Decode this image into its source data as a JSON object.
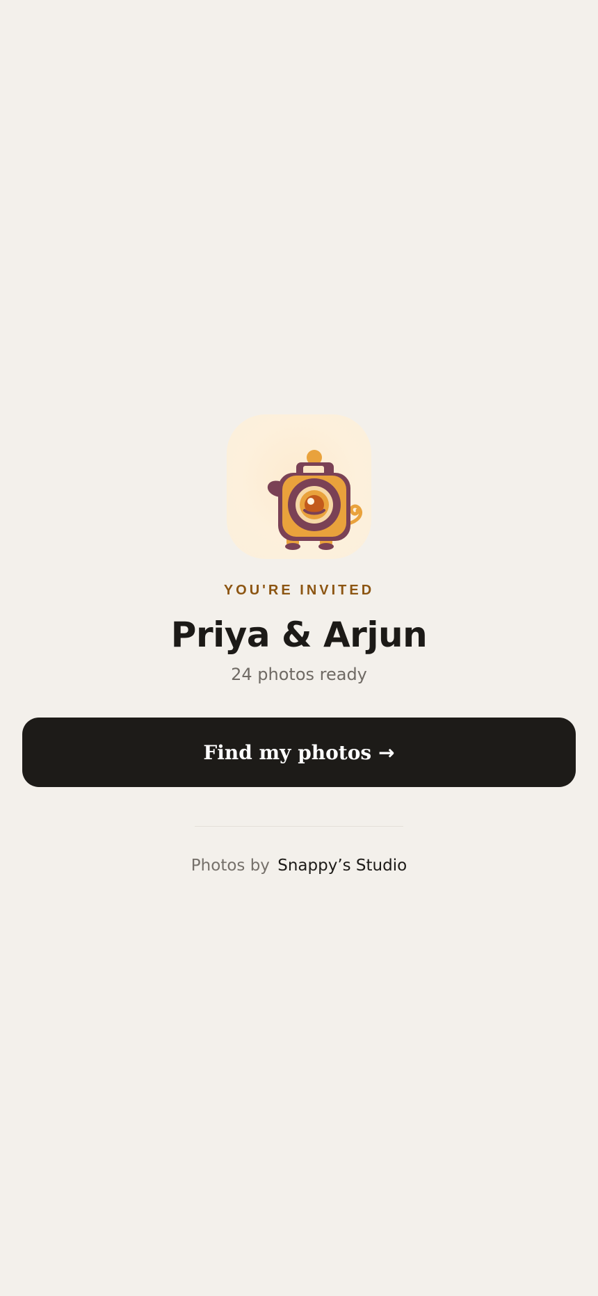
{
  "brand": {
    "logo_icon": "camera-mascot-icon",
    "accent_color": "#8c5512",
    "tile_color": "#fdebd0"
  },
  "invite": {
    "eyebrow": "YOU'RE INVITED",
    "title": "Priya & Arjun",
    "subtitle": "24 photos ready"
  },
  "cta": {
    "label": "Find my photos",
    "arrow": "→",
    "color": "#1d1b18"
  },
  "footer": {
    "prefix": "Photos by",
    "studio": "Snappy’s Studio"
  }
}
